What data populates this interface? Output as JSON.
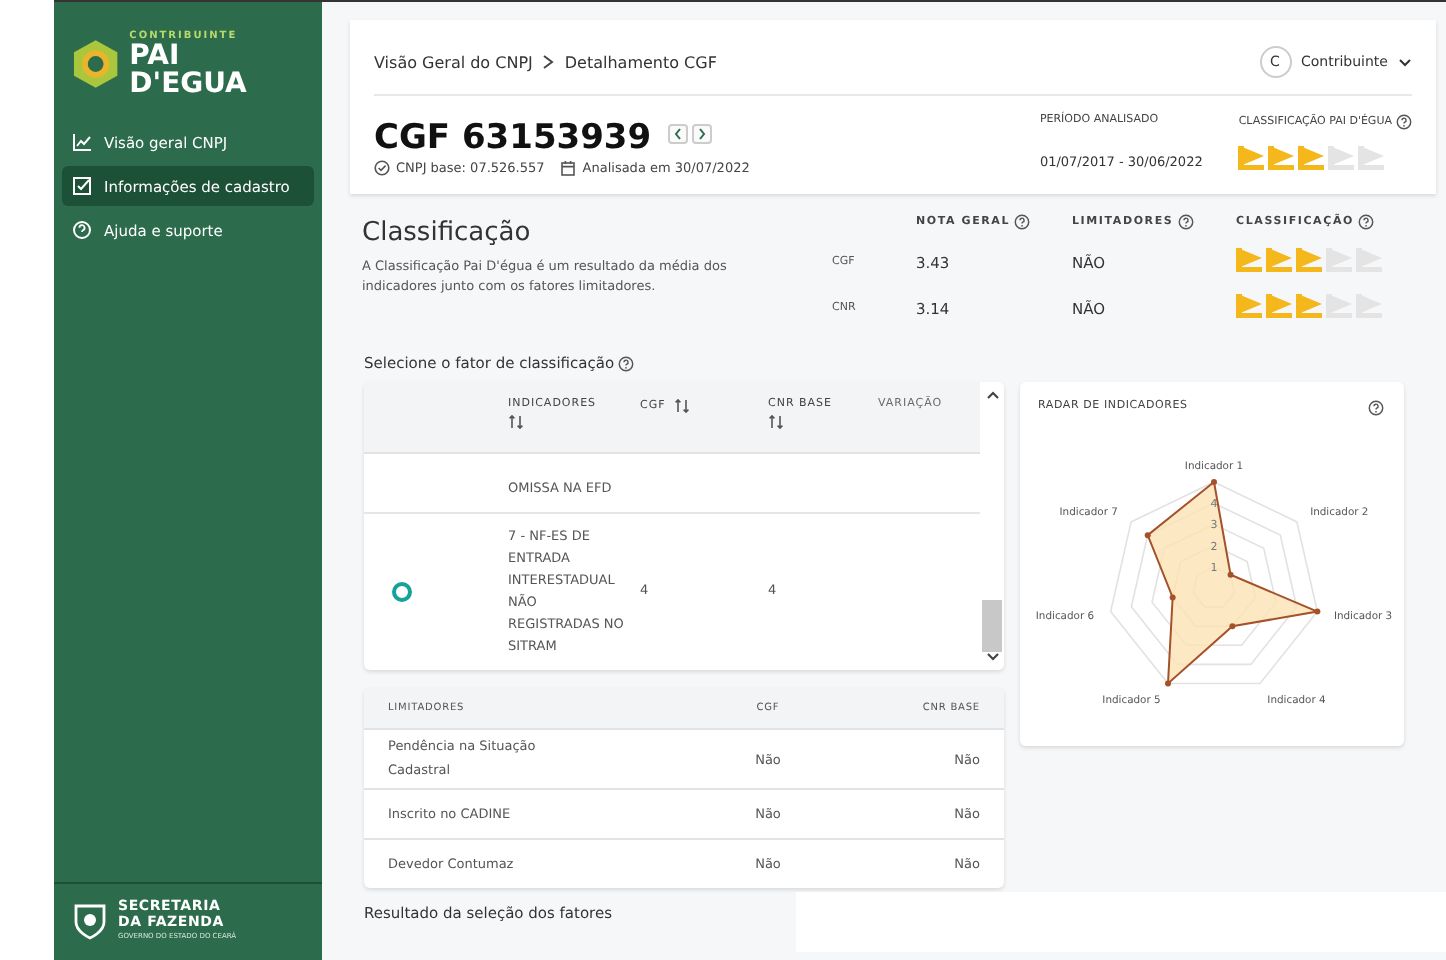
{
  "sidebar": {
    "logo": {
      "overline": "CONTRIBUINTE",
      "name": "PAI D'EGUA"
    },
    "items": [
      {
        "label": "Visão geral CNPJ",
        "kind": "chart",
        "selected": false
      },
      {
        "label": "Informações de cadastro",
        "kind": "checklist",
        "selected": true
      },
      {
        "label": "Ajuda e suporte",
        "kind": "help",
        "selected": false
      }
    ],
    "footer": {
      "line1": "SECRETARIA",
      "line2": "DA FAZENDA",
      "subtitle": "GOVERNO DO ESTADO DO CEARÁ"
    }
  },
  "header": {
    "breadcrumb": [
      "Visão Geral do CNPJ",
      "Detalhamento CGF"
    ],
    "user": {
      "initial": "C",
      "name": "Contribuinte"
    },
    "title": "CGF 63153939",
    "cnpj": "CNPJ base: 07.526.557",
    "analyzed": "Analisada em 30/07/2022",
    "period": {
      "label": "PERÍODO ANALISADO",
      "value": "01/07/2017 - 30/06/2022"
    },
    "rating": {
      "label": "CLASSIFICAÇÃO PAI D'ÉGUA",
      "stars": 3
    }
  },
  "classification": {
    "title": "Classificação",
    "description": "A Classificação Pai D'égua é um resultado da média dos indicadores junto com os fatores limitadores.",
    "columns": [
      "NOTA GERAL",
      "LIMITADORES",
      "CLASSIFICAÇÃO"
    ],
    "rows": [
      {
        "label": "CGF",
        "nota": "3.43",
        "limitadores": "NÃO",
        "stars": 3
      },
      {
        "label": "CNR",
        "nota": "3.14",
        "limitadores": "NÃO",
        "stars": 3
      }
    ]
  },
  "factors": {
    "title": "Selecione o fator de classificação",
    "columns": [
      {
        "label": "INDICADORES",
        "sortable": true
      },
      {
        "label": "CGF",
        "sortable": true
      },
      {
        "label": "CNR BASE",
        "sortable": true
      },
      {
        "label": "VARIAÇÃO",
        "sortable": false
      }
    ],
    "rows": [
      {
        "indicator": "OMISSA NA EFD"
      },
      {
        "indicator": "7 - NF-ES DE ENTRADA INTERESTADUAL NÃO REGISTRADAS NO SITRAM",
        "cgf": "4",
        "cnr": "4",
        "selected": true
      }
    ]
  },
  "radar": {
    "title": "RADAR DE INDICADORES",
    "axes": [
      "Indicador 1",
      "Indicador 2",
      "Indicador 3",
      "Indicador 4",
      "Indicador 5",
      "Indicador 6",
      "Indicador 7"
    ],
    "ticks": [
      "4",
      "3",
      "2",
      "1"
    ]
  },
  "limits": {
    "columns": [
      "LIMITADORES",
      "CGF",
      "CNR BASE"
    ],
    "rows": [
      [
        "Pendência na Situação Cadastral",
        "Não",
        "Não"
      ],
      [
        "Inscrito no CADINE",
        "Não",
        "Não"
      ],
      [
        "Devedor Contumaz",
        "Não",
        "Não"
      ]
    ]
  },
  "result": {
    "title": "Resultado da seleção dos fatores"
  }
}
